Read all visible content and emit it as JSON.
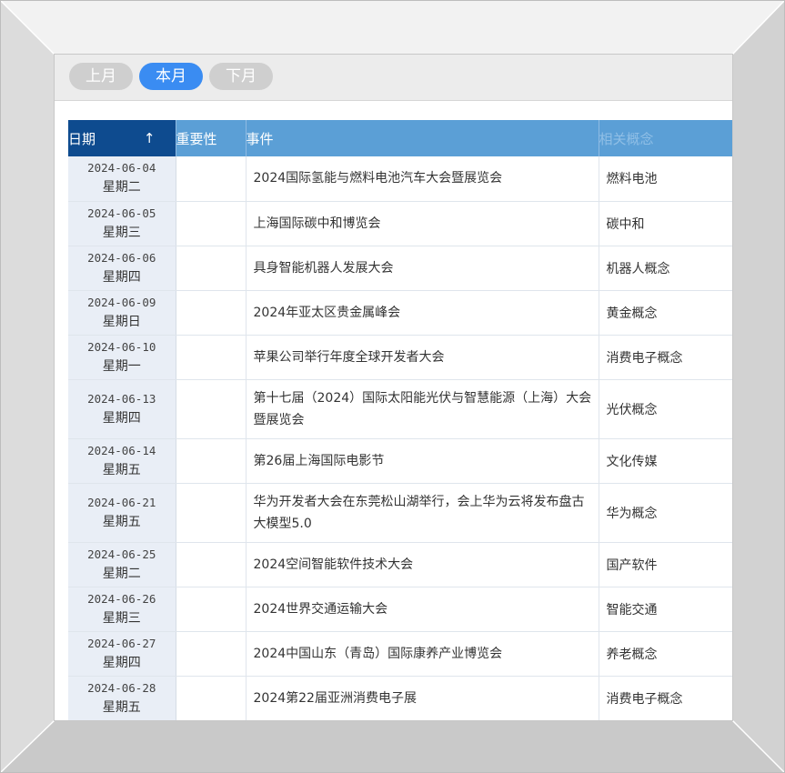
{
  "nav": {
    "prev": "上月",
    "current": "本月",
    "next": "下月"
  },
  "table": {
    "headers": {
      "date": "日期",
      "importance": "重要性",
      "event": "事件",
      "concept": "相关概念"
    },
    "sort_arrow": "↑",
    "rows": [
      {
        "date": "2024-06-04",
        "weekday": "星期二",
        "event": "2024国际氢能与燃料电池汽车大会暨展览会",
        "concept": "燃料电池"
      },
      {
        "date": "2024-06-05",
        "weekday": "星期三",
        "event": "上海国际碳中和博览会",
        "concept": "碳中和"
      },
      {
        "date": "2024-06-06",
        "weekday": "星期四",
        "event": "具身智能机器人发展大会",
        "concept": "机器人概念"
      },
      {
        "date": "2024-06-09",
        "weekday": "星期日",
        "event": "2024年亚太区贵金属峰会",
        "concept": "黄金概念"
      },
      {
        "date": "2024-06-10",
        "weekday": "星期一",
        "event": "苹果公司举行年度全球开发者大会",
        "concept": "消费电子概念"
      },
      {
        "date": "2024-06-13",
        "weekday": "星期四",
        "event": "第十七届（2024）国际太阳能光伏与智慧能源（上海）大会暨展览会",
        "concept": "光伏概念"
      },
      {
        "date": "2024-06-14",
        "weekday": "星期五",
        "event": "第26届上海国际电影节",
        "concept": "文化传媒"
      },
      {
        "date": "2024-06-21",
        "weekday": "星期五",
        "event": "华为开发者大会在东莞松山湖举行，会上华为云将发布盘古大模型5.0",
        "concept": "华为概念"
      },
      {
        "date": "2024-06-25",
        "weekday": "星期二",
        "event": "2024空间智能软件技术大会",
        "concept": "国产软件"
      },
      {
        "date": "2024-06-26",
        "weekday": "星期三",
        "event": "2024世界交通运输大会",
        "concept": "智能交通"
      },
      {
        "date": "2024-06-27",
        "weekday": "星期四",
        "event": "2024中国山东（青岛）国际康养产业博览会",
        "concept": "养老概念"
      },
      {
        "date": "2024-06-28",
        "weekday": "星期五",
        "event": "2024第22届亚洲消费电子展",
        "concept": "消费电子概念"
      }
    ]
  }
}
